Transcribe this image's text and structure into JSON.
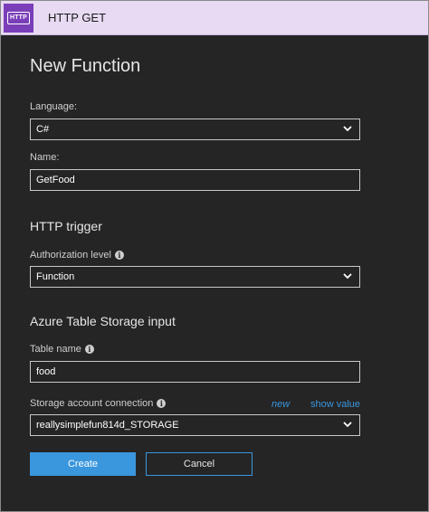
{
  "header": {
    "icon_text": "HTTP",
    "title": "HTTP GET"
  },
  "page_title": "New Function",
  "language": {
    "label": "Language:",
    "value": "C#"
  },
  "name": {
    "label": "Name:",
    "value": "GetFood"
  },
  "http_trigger": {
    "heading": "HTTP trigger",
    "auth_label": "Authorization level",
    "auth_value": "Function"
  },
  "table_input": {
    "heading": "Azure Table Storage input",
    "table_name_label": "Table name",
    "table_name_value": "food",
    "storage_label": "Storage account connection",
    "new_link": "new",
    "show_value_link": "show value",
    "storage_value": "reallysimplefun814d_STORAGE"
  },
  "buttons": {
    "create": "Create",
    "cancel": "Cancel"
  },
  "icons": {
    "info": "info-icon",
    "dropdown": "chevron-down-icon"
  },
  "colors": {
    "header_bg": "#e7daf2",
    "icon_bg": "#7a3eb8",
    "panel_bg": "#252526",
    "accent": "#3a96dd"
  }
}
